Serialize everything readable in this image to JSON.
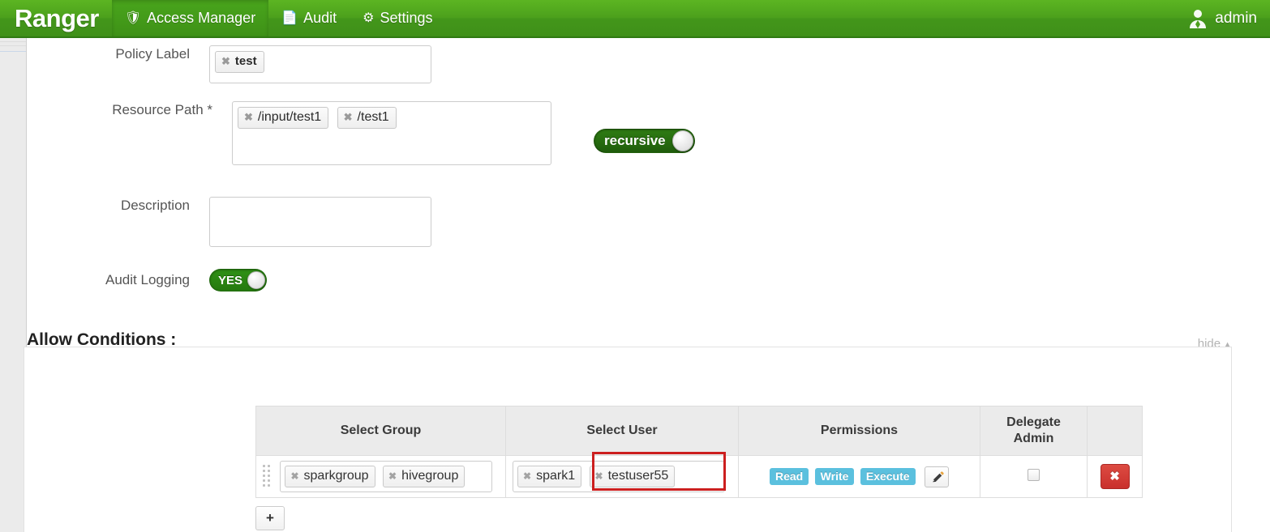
{
  "header": {
    "brand": "Ranger",
    "nav": [
      {
        "label": "Access Manager",
        "icon": "shield-icon",
        "active": true
      },
      {
        "label": "Audit",
        "icon": "file-icon",
        "active": false
      },
      {
        "label": "Settings",
        "icon": "gear-icon",
        "active": false
      }
    ],
    "user": {
      "label": "admin",
      "icon": "user-icon"
    },
    "brand_color": "#4ca01c"
  },
  "form": {
    "policy_label": {
      "label": "Policy Label",
      "tags": [
        "test"
      ]
    },
    "resource_path": {
      "label": "Resource Path *",
      "tags": [
        "/input/test1",
        "/test1"
      ]
    },
    "recursive": {
      "label": "recursive",
      "state": "on"
    },
    "description": {
      "label": "Description",
      "value": "",
      "placeholder": ""
    },
    "audit_logging": {
      "label": "Audit Logging",
      "state": "YES"
    }
  },
  "allow_conditions": {
    "title": "Allow Conditions :",
    "hide_label": "hide",
    "hide_chevron": "▲",
    "columns": [
      "Select Group",
      "Select User",
      "Permissions",
      "Delegate Admin",
      ""
    ],
    "delegate_admin_line1": "Delegate",
    "delegate_admin_line2": "Admin",
    "rows": [
      {
        "groups": [
          "sparkgroup",
          "hivegroup"
        ],
        "users": [
          "spark1",
          "testuser55"
        ],
        "permissions": [
          "Read",
          "Write",
          "Execute"
        ],
        "edit_icon": "pencil-icon",
        "delegate_admin": false,
        "delete_label": "✖",
        "highlight_user": "testuser55",
        "highlight_color": "#cc1f1f"
      }
    ],
    "add_label": "+",
    "permission_badge_color": "#5bc0de",
    "delete_button_color": "#c9302c"
  }
}
